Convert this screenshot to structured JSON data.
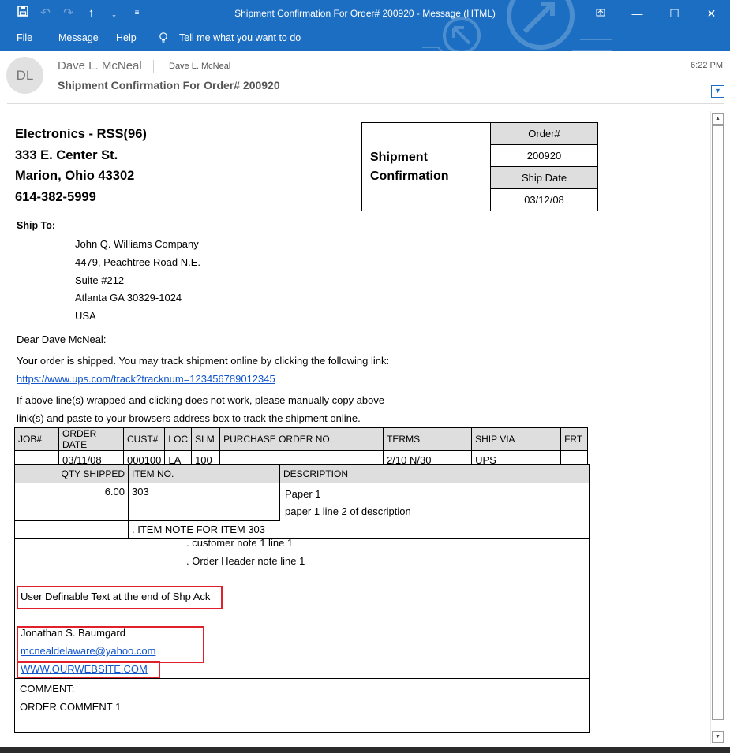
{
  "window": {
    "title": "Shipment Confirmation For Order# 200920  -  Message (HTML)",
    "quick_access": [
      "save-icon",
      "undo-icon",
      "redo-icon",
      "up-arrow-icon",
      "down-arrow-icon",
      "customize-icon"
    ],
    "controls": [
      "restore-icon",
      "minimize-icon",
      "maximize-icon",
      "close-icon"
    ]
  },
  "menu": {
    "file": "File",
    "message": "Message",
    "help": "Help",
    "tell_me": "Tell me what you want to do"
  },
  "email": {
    "avatar_initials": "DL",
    "sender": "Dave L. McNeal",
    "recipient": "Dave L. McNeal",
    "subject": "Shipment Confirmation For Order# 200920",
    "time": "6:22 PM"
  },
  "company": {
    "name": "Electronics - RSS(96)",
    "street": "333 E. Center St.",
    "city": "Marion, Ohio 43302",
    "phone": "614-382-5999"
  },
  "confirmation": {
    "title_line1": "Shipment",
    "title_line2": "Confirmation",
    "order_label": "Order#",
    "order_value": "200920",
    "date_label": "Ship Date",
    "date_value": "03/12/08"
  },
  "ship_to": {
    "label": "Ship To:",
    "lines": [
      "John Q. Williams Company",
      "4479, Peachtree Road N.E.",
      "Suite #212",
      "Atlanta GA 30329-1024",
      "USA"
    ]
  },
  "letter": {
    "greeting": "Dear Dave McNeal:",
    "shipped": "Your order is shipped. You may track shipment online by clicking the following link:",
    "track_link": "https://www.ups.com/track?tracknum=123456789012345",
    "note_line1": "If above line(s) wrapped and clicking does not work, please manually copy above",
    "note_line2": "link(s) and paste to your browsers address box to track the shipment online."
  },
  "order_table": {
    "headers": [
      "JOB#",
      "ORDER DATE",
      "CUST#",
      "LOC",
      "SLM",
      "PURCHASE ORDER NO.",
      "TERMS",
      "SHIP VIA",
      "FRT"
    ],
    "row": [
      "",
      "03/11/08",
      "000100",
      "LA",
      "100",
      "",
      "2/10 N/30",
      "UPS",
      ""
    ]
  },
  "items_table": {
    "headers": [
      "QTY SHIPPED",
      "ITEM NO.",
      "DESCRIPTION"
    ],
    "qty": "6.00",
    "item_no": "303",
    "desc_line1": "Paper 1",
    "desc_line2": "paper 1 line 2 of description",
    "item_note": ". ITEM NOTE FOR ITEM 303"
  },
  "notes": {
    "customer_note": ". customer note 1 line 1",
    "header_note": ". Order Header note line 1",
    "user_text": "User Definable Text at the end of Shp Ack",
    "contact_name": "Jonathan S. Baumgard",
    "contact_email": "mcnealdelaware@yahoo.com",
    "website": "WWW.OURWEBSITE.COM"
  },
  "comment": {
    "label": "COMMENT:",
    "text": "ORDER COMMENT 1"
  },
  "colors": {
    "titlebar": "#1b6ec2",
    "highlight_box": "#e0202a",
    "link": "#1155cc",
    "header_cell": "#dedede"
  }
}
